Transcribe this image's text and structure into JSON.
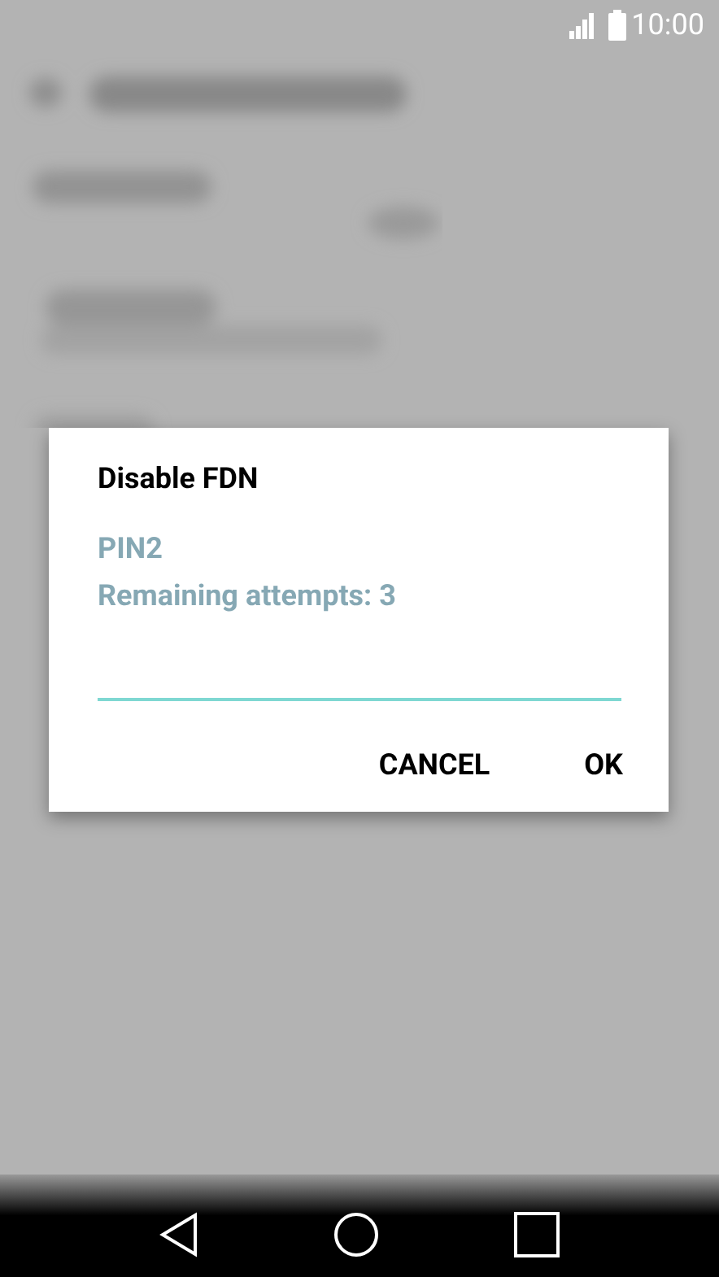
{
  "status_bar": {
    "time": "10:00"
  },
  "dialog": {
    "title": "Disable FDN",
    "label": "PIN2",
    "hint": "Remaining attempts: 3",
    "buttons": [
      {
        "label": "CANCEL"
      },
      {
        "label": "OK"
      }
    ]
  }
}
